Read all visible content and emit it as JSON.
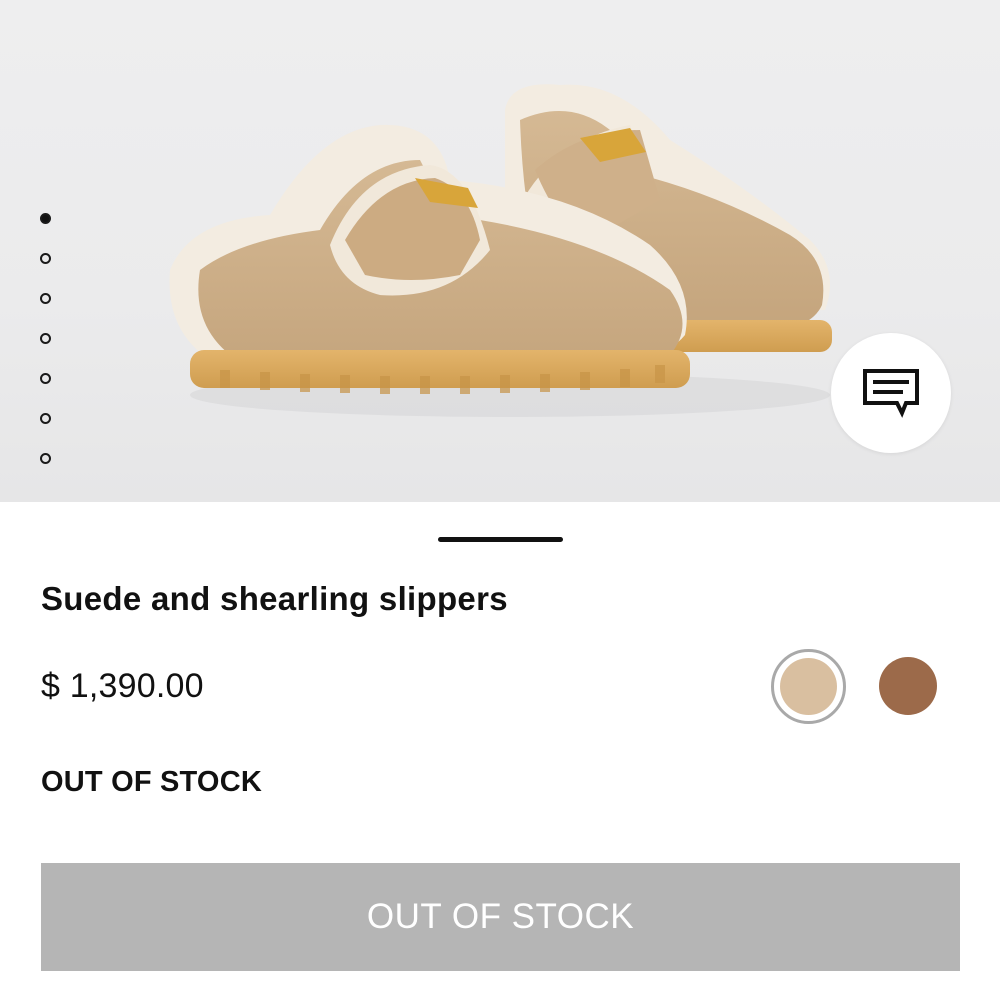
{
  "gallery": {
    "image_alt": "",
    "page_count": 7,
    "active_page": 1
  },
  "chat_button": {
    "icon": "chat-icon"
  },
  "product": {
    "name": "Suede and shearling slippers",
    "price": "$ 1,390.00",
    "stock_status": "OUT OF STOCK"
  },
  "colors": [
    {
      "hex": "#d9bfa0",
      "selected": true
    },
    {
      "hex": "#9c6a4a",
      "selected": false
    }
  ],
  "cta": {
    "label": "OUT OF STOCK",
    "enabled": false,
    "background": "#b5b5b5"
  }
}
